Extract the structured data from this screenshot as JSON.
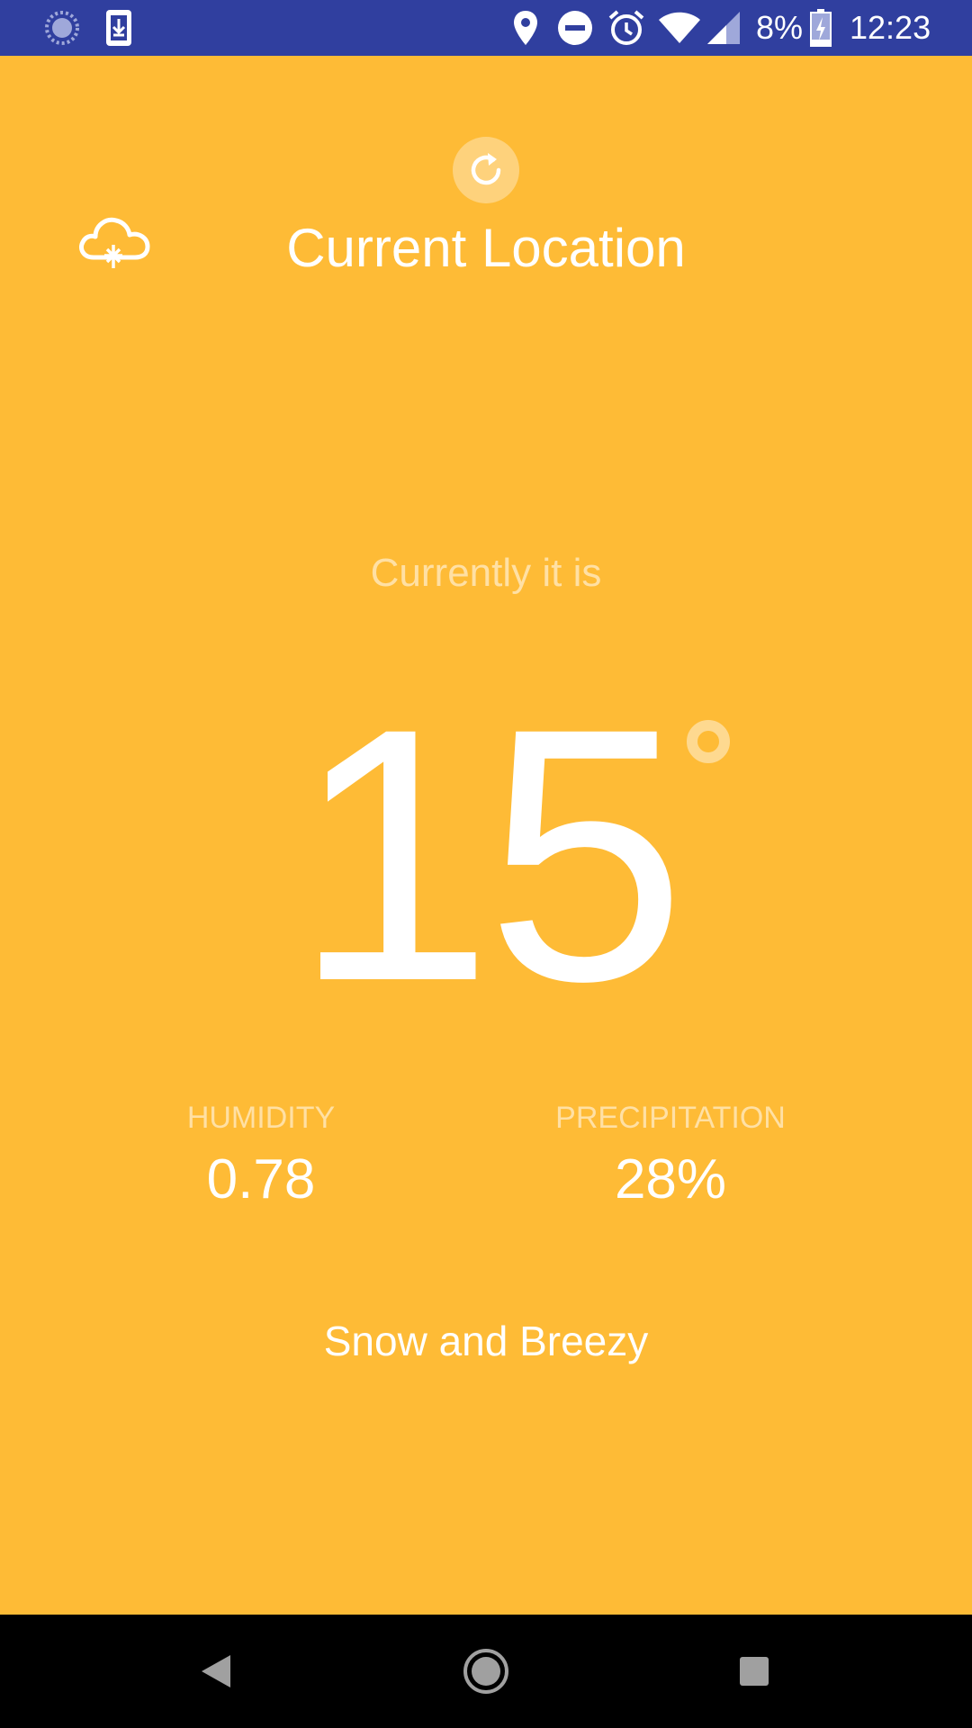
{
  "status_bar": {
    "battery_percent": "8%",
    "time": "12:23",
    "icons": [
      "sync-icon",
      "download-icon",
      "location-icon",
      "do-not-disturb-icon",
      "alarm-icon",
      "wifi-icon",
      "signal-icon",
      "battery-charging-icon"
    ]
  },
  "header": {
    "location": "Current Location",
    "refresh_icon": "refresh-icon",
    "weather_icon": "cloud-icon"
  },
  "main": {
    "currently_label": "Currently it is",
    "temperature": "15",
    "humidity": {
      "label": "HUMIDITY",
      "value": "0.78"
    },
    "precipitation": {
      "label": "PRECIPITATION",
      "value": "28%"
    },
    "summary": "Snow and Breezy"
  },
  "colors": {
    "background": "#FEBB36",
    "status_bar": "#303F9F",
    "nav_bar": "#000000",
    "text": "#FFFFFF"
  },
  "nav_bar": {
    "buttons": [
      "back-icon",
      "home-icon",
      "recents-icon"
    ]
  }
}
